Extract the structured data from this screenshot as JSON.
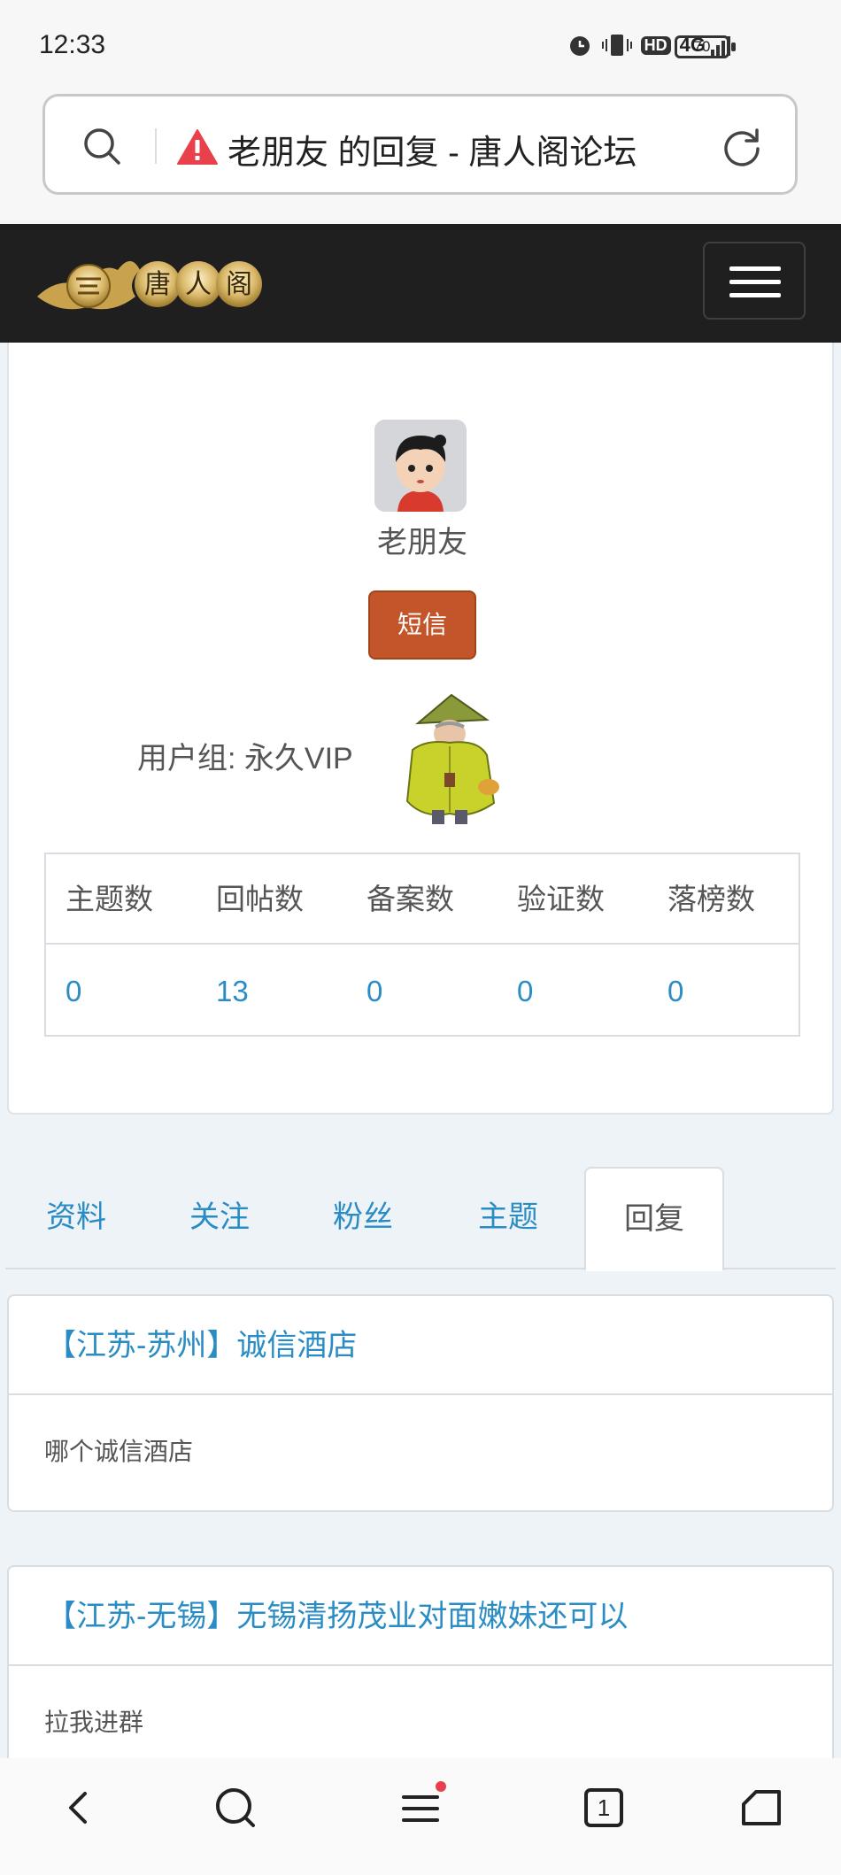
{
  "status_bar": {
    "time": "12:33",
    "icons": [
      "alarm-icon",
      "vibrate-icon",
      "hd-icon",
      "4g-signal-icon"
    ],
    "hd_text": "HD",
    "network_text": "4G",
    "battery": "70"
  },
  "address_bar": {
    "title": "老朋友 的回复 - 唐人阁论坛"
  },
  "site": {
    "logo_text": "唐人阁"
  },
  "profile": {
    "username": "老朋友",
    "pm_button": "短信",
    "group_label": "用户组: 永久VIP",
    "stats": {
      "headers": [
        "主题数",
        "回帖数",
        "备案数",
        "验证数",
        "落榜数"
      ],
      "values": [
        "0",
        "13",
        "0",
        "0",
        "0"
      ]
    }
  },
  "tabs": [
    "资料",
    "关注",
    "粉丝",
    "主题",
    "回复"
  ],
  "active_tab": "回复",
  "posts": [
    {
      "title": "【江苏-苏州】诚信酒店",
      "body": "哪个诚信酒店"
    },
    {
      "title": "【江苏-无锡】无锡清扬茂业对面嫩妹还可以",
      "body": "拉我进群"
    }
  ],
  "bottom_nav": {
    "tab_count": "1",
    "icons": [
      "back-icon",
      "search-icon",
      "menu-icon",
      "tabs-icon",
      "home-icon"
    ]
  },
  "colors": {
    "link": "#2a8cc4",
    "pm_button": "#c2562a",
    "header_bg": "#1f1f1f",
    "page_bg": "#eef3f7"
  }
}
